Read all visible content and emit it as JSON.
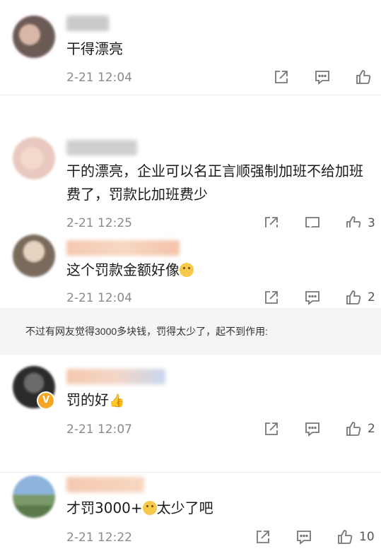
{
  "comments": [
    {
      "text": "干得漂亮",
      "time": "2-21 12:04",
      "likes": ""
    },
    {
      "text": "干的漂亮，企业可以名正言顺强制加班不给加班费了，罚款比加班费少",
      "time": "2-21 12:25",
      "likes": "3"
    },
    {
      "text_prefix": "这个罚款金额好像",
      "time": "2-21 12:04",
      "likes": "2"
    },
    {
      "text_prefix": "罚的好",
      "time": "2-21 12:07",
      "likes": "2"
    },
    {
      "text_prefix": "才罚3000+",
      "text_suffix": "太少了吧",
      "time": "2-21 12:22",
      "likes": "10"
    }
  ],
  "banner": {
    "text": "不过有网友觉得3000多块钱，罚得太少了，起不到作用:"
  },
  "icons": {
    "share": "share-icon",
    "comment": "comment-icon",
    "like": "thumbs-up-icon"
  },
  "colors": {
    "badge": "#f6a623",
    "banner_bg": "#f5f5f5",
    "meta": "#8a8a8a"
  }
}
